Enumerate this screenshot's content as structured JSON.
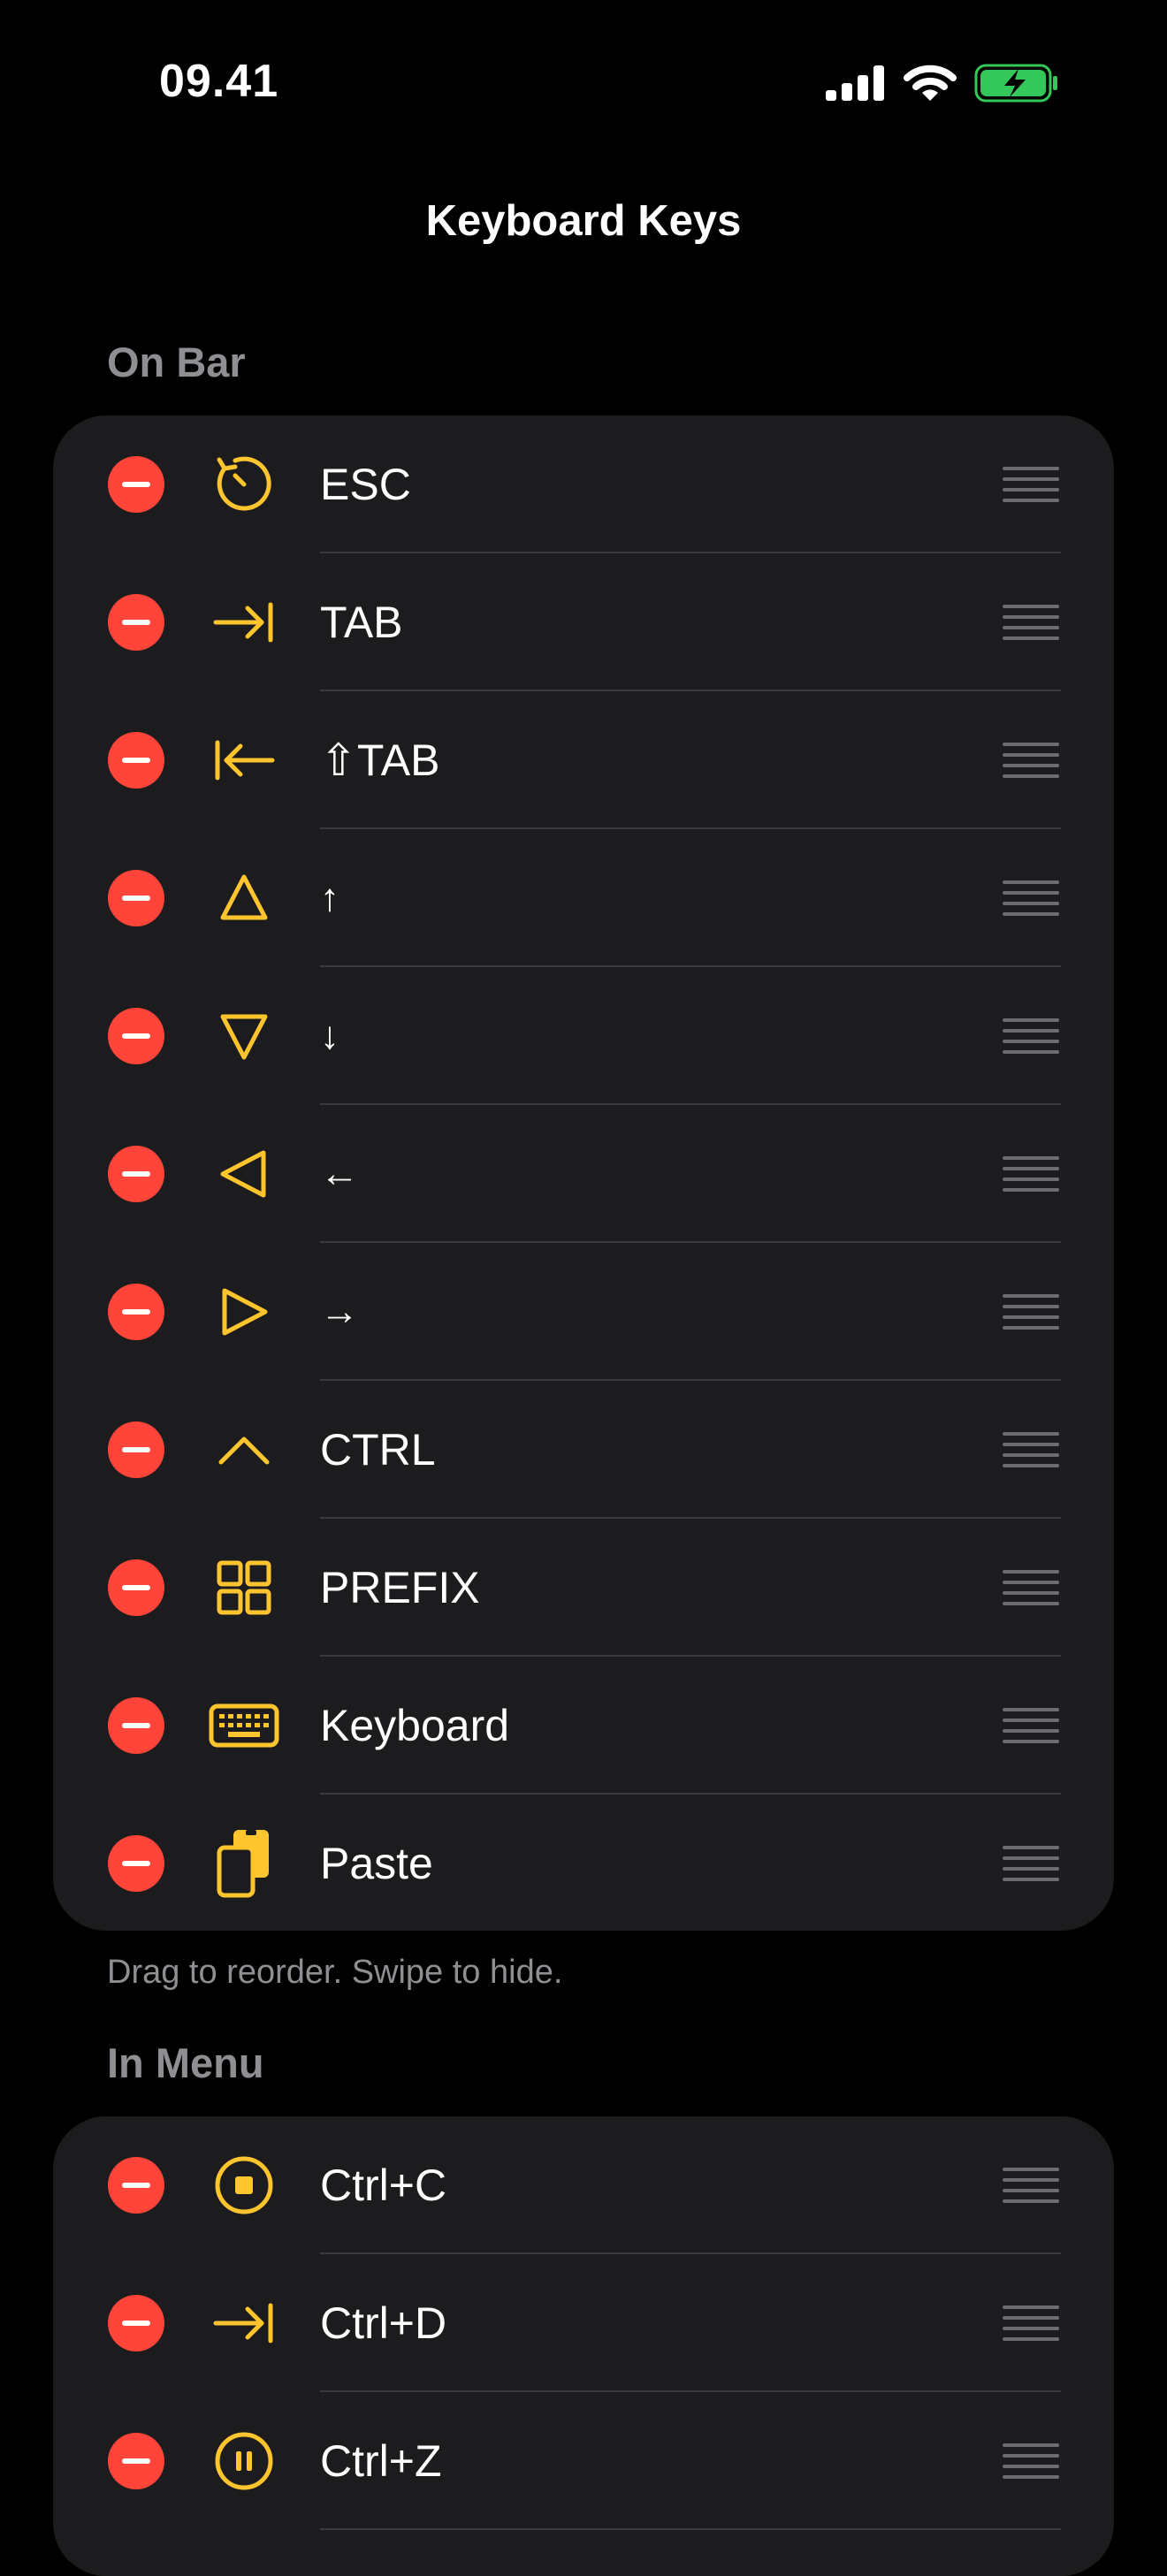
{
  "status_bar": {
    "time": "09.41"
  },
  "nav": {
    "title": "Keyboard Keys"
  },
  "sections": {
    "on_bar": {
      "header": "On Bar",
      "items": [
        {
          "label": "ESC",
          "icon": "escape-icon"
        },
        {
          "label": "TAB",
          "icon": "tab-forward-icon"
        },
        {
          "label": "⇧TAB",
          "icon": "tab-backward-icon"
        },
        {
          "label": "↑",
          "icon": "triangle-up-icon"
        },
        {
          "label": "↓",
          "icon": "triangle-down-icon"
        },
        {
          "label": "←",
          "icon": "triangle-left-icon"
        },
        {
          "label": "→",
          "icon": "triangle-right-icon"
        },
        {
          "label": "CTRL",
          "icon": "control-icon"
        },
        {
          "label": "PREFIX",
          "icon": "grid-icon"
        },
        {
          "label": "Keyboard",
          "icon": "keyboard-icon"
        },
        {
          "label": "Paste",
          "icon": "paste-icon"
        }
      ],
      "footer": "Drag to reorder. Swipe to hide."
    },
    "in_menu": {
      "header": "In Menu",
      "items": [
        {
          "label": "Ctrl+C",
          "icon": "stop-circle-icon"
        },
        {
          "label": "Ctrl+D",
          "icon": "tab-forward-icon"
        },
        {
          "label": "Ctrl+Z",
          "icon": "pause-circle-icon"
        }
      ]
    }
  },
  "colors": {
    "accent": "#FFC52E",
    "delete": "#FF453A",
    "card": "#1C1C1E",
    "battery": "#34C759"
  }
}
